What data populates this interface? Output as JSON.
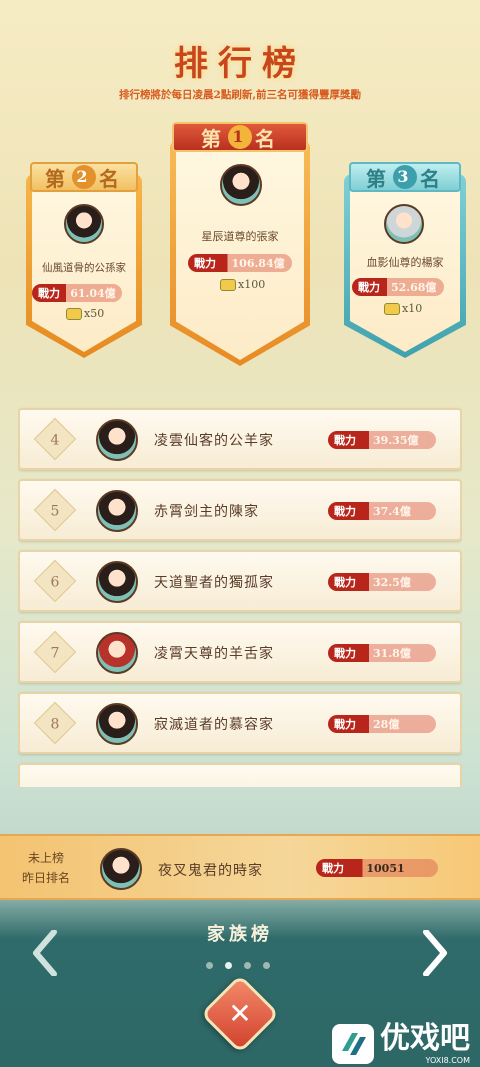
{
  "header": {
    "title": "排行榜",
    "subtitle": "排行榜將於每日凌晨2點刷新,前三名可獲得豐厚獎勵"
  },
  "top3": [
    {
      "rank_prefix": "第",
      "rank_num": "1",
      "rank_suffix": "名",
      "name": "星辰道尊的張家",
      "power_label": "戰力",
      "power": "106.84億",
      "reward": "x100"
    },
    {
      "rank_prefix": "第",
      "rank_num": "2",
      "rank_suffix": "名",
      "name": "仙風道骨的公孫家",
      "power_label": "戰力",
      "power": "61.04億",
      "reward": "x50"
    },
    {
      "rank_prefix": "第",
      "rank_num": "3",
      "rank_suffix": "名",
      "name": "血影仙尊的楊家",
      "power_label": "戰力",
      "power": "52.68億",
      "reward": "x10"
    }
  ],
  "rows": [
    {
      "rank": "4",
      "name": "凌雲仙客的公羊家",
      "power_label": "戰力",
      "power": "39.35億"
    },
    {
      "rank": "5",
      "name": "赤霄剑主的陳家",
      "power_label": "戰力",
      "power": "37.4億"
    },
    {
      "rank": "6",
      "name": "天道聖者的獨孤家",
      "power_label": "戰力",
      "power": "32.5億"
    },
    {
      "rank": "7",
      "name": "凌霄天尊的羊舌家",
      "power_label": "戰力",
      "power": "31.8億"
    },
    {
      "rank": "8",
      "name": "寂滅道者的慕容家",
      "power_label": "戰力",
      "power": "28億"
    }
  ],
  "my_rank": {
    "line1": "未上榜",
    "line2": "昨日排名",
    "name": "夜叉鬼君的時家",
    "power_label": "戰力",
    "power": "10051"
  },
  "nav": {
    "tab_title": "家族榜",
    "close_symbol": "✕",
    "prev_icon": "chevron-left-icon",
    "next_icon": "chevron-right-icon"
  },
  "watermark": {
    "brand": "优戏吧",
    "site": "YOXI8.COM"
  },
  "colors": {
    "gold": "#f0a93a",
    "red": "#c8461d",
    "teal": "#5fb8c4",
    "power_red": "#b8261b"
  }
}
